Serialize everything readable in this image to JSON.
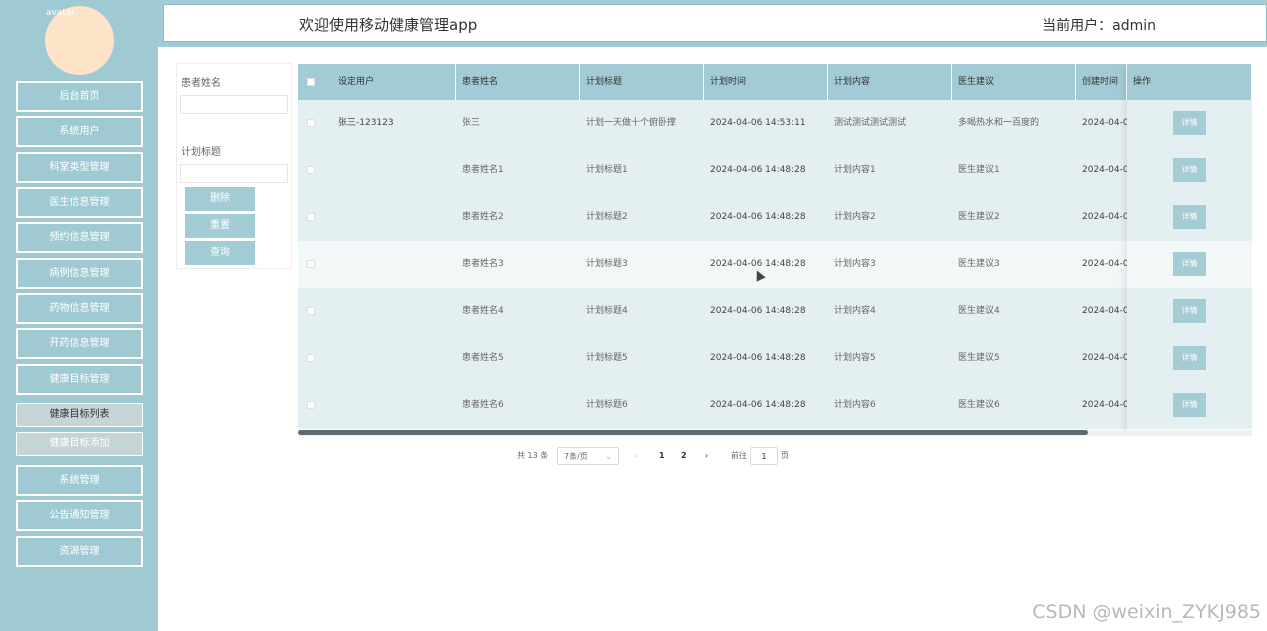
{
  "sidebar": {
    "avatar_alt": "avatar",
    "menu": [
      "后台首页",
      "系统用户",
      "科室类型管理",
      "医生信息管理",
      "预约信息管理",
      "病例信息管理",
      "药物信息管理",
      "开药信息管理",
      "健康目标管理"
    ],
    "sub_menu": [
      "健康目标列表",
      "健康目标添加"
    ],
    "menu_bottom": [
      "系统管理",
      "公告通知管理",
      "资源管理"
    ]
  },
  "header": {
    "title": "欢迎使用移动健康管理app",
    "current_user": "当前用户：admin"
  },
  "filter": {
    "patient_name_label": "患者姓名",
    "plan_title_label": "计划标题",
    "delete_label": "删除",
    "reset_label": "重置",
    "query_label": "查询"
  },
  "table": {
    "columns": [
      "设定用户",
      "患者姓名",
      "计划标题",
      "计划时间",
      "计划内容",
      "医生建议",
      "创建时间",
      "操作"
    ],
    "detail_label": "详情",
    "rows": [
      {
        "user": "张三-123123",
        "patient": "张三",
        "title": "计划一天做十个俯卧撑",
        "time": "2024-04-06 14:53:11",
        "content": "测试测试测试测试",
        "advice": "多喝热水和一百度的",
        "created": "2024-04-0"
      },
      {
        "user": "",
        "patient": "患者姓名1",
        "title": "计划标题1",
        "time": "2024-04-06 14:48:28",
        "content": "计划内容1",
        "advice": "医生建议1",
        "created": "2024-04-0"
      },
      {
        "user": "",
        "patient": "患者姓名2",
        "title": "计划标题2",
        "time": "2024-04-06 14:48:28",
        "content": "计划内容2",
        "advice": "医生建议2",
        "created": "2024-04-0"
      },
      {
        "user": "",
        "patient": "患者姓名3",
        "title": "计划标题3",
        "time": "2024-04-06 14:48:28",
        "content": "计划内容3",
        "advice": "医生建议3",
        "created": "2024-04-0"
      },
      {
        "user": "",
        "patient": "患者姓名4",
        "title": "计划标题4",
        "time": "2024-04-06 14:48:28",
        "content": "计划内容4",
        "advice": "医生建议4",
        "created": "2024-04-0"
      },
      {
        "user": "",
        "patient": "患者姓名5",
        "title": "计划标题5",
        "time": "2024-04-06 14:48:28",
        "content": "计划内容5",
        "advice": "医生建议5",
        "created": "2024-04-0"
      },
      {
        "user": "",
        "patient": "患者姓名6",
        "title": "计划标题6",
        "time": "2024-04-06 14:48:28",
        "content": "计划内容6",
        "advice": "医生建议6",
        "created": "2024-04-0"
      }
    ]
  },
  "pagination": {
    "total": "共 13 条",
    "page_size": "7条/页",
    "prev_icon": "‹",
    "pages": [
      "1",
      "2"
    ],
    "next_icon": "›",
    "goto_prefix": "前往",
    "goto_value": "1",
    "goto_suffix": "页"
  },
  "watermark": "CSDN @weixin_ZYKJ985",
  "colors": {
    "accent": "#a2cbd5",
    "sidebar": "#9fcad3",
    "row": "#e4eff2"
  }
}
